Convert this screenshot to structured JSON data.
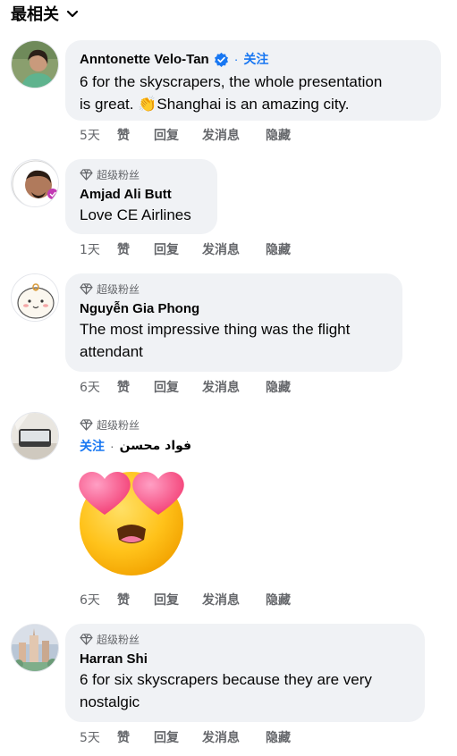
{
  "header": {
    "sort_label": "最相关"
  },
  "badge_label": "超级粉丝",
  "actions": {
    "like": "赞",
    "reply": "回复",
    "message": "发消息",
    "hide": "隐藏"
  },
  "comments": [
    {
      "name": "Anntonette Velo-Tan",
      "verified": true,
      "follow": "关注",
      "text_line1": "6 for the skyscrapers, the whole presentation",
      "text_line2_a": "is great. ",
      "text_line2_emoji": "👏",
      "text_line2_b": "Shanghai is an amazing city.",
      "time": "5天"
    },
    {
      "name": "Amjad Ali Butt",
      "text": "Love CE Airlines",
      "time": "1天"
    },
    {
      "name": "Nguyễn Gia Phong",
      "text_line1": "The most impressive thing was the flight",
      "text_line2": "attendant",
      "time": "6天"
    },
    {
      "name": "فواد محسن",
      "follow": "关注",
      "emoji": "heart-eyes",
      "time": "6天"
    },
    {
      "name": "Harran Shi",
      "text_line1": "6 for six skyscrapers because they are very",
      "text_line2": "nostalgic",
      "time": "5天"
    }
  ]
}
